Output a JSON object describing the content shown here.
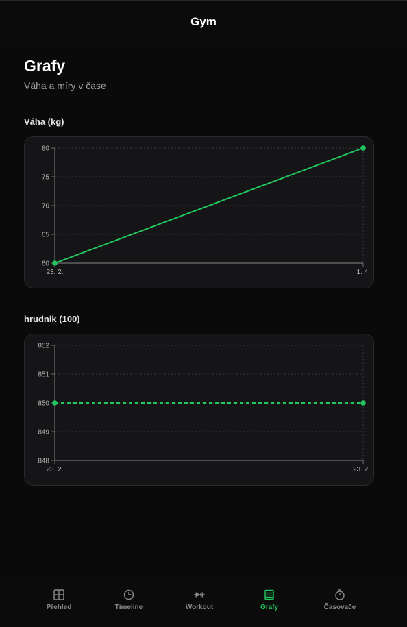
{
  "header": {
    "title": "Gym"
  },
  "page": {
    "title": "Grafy",
    "subtitle": "Váha a míry v čase"
  },
  "colors": {
    "accent": "#22c55e",
    "background": "#0a0a0a",
    "card": "#151517",
    "muted": "#8a8a8a"
  },
  "chart_data": [
    {
      "type": "line",
      "title": "Váha (kg)",
      "x": [
        "23. 2.",
        "1. 4."
      ],
      "series": [
        {
          "values": [
            60,
            80
          ]
        }
      ],
      "ylim": [
        60,
        80
      ],
      "yticks": [
        60,
        65,
        70,
        75,
        80
      ],
      "grid": true,
      "line_style": "solid"
    },
    {
      "type": "line",
      "title": "hrudnik (100)",
      "x": [
        "23. 2.",
        "23. 2."
      ],
      "series": [
        {
          "values": [
            850,
            850
          ]
        }
      ],
      "ylim": [
        848,
        852
      ],
      "yticks": [
        848,
        849,
        850,
        851,
        852
      ],
      "grid": true,
      "line_style": "dashed"
    }
  ],
  "nav": {
    "items": [
      {
        "label": "Přehled",
        "icon": "grid-icon"
      },
      {
        "label": "Timeline",
        "icon": "clock-icon"
      },
      {
        "label": "Workout",
        "icon": "dumbbell-icon"
      },
      {
        "label": "Grafy",
        "icon": "chart-icon",
        "active": true
      },
      {
        "label": "Časovače",
        "icon": "stopwatch-icon"
      }
    ]
  }
}
